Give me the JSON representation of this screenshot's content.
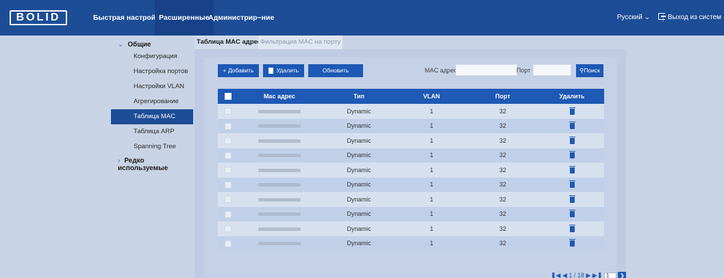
{
  "header": {
    "logo": "BOLID",
    "nav": [
      "Быстрая настройка",
      "Расширенные",
      "Администрир~ние"
    ],
    "active_nav": "Расширенные",
    "language": "Русский ⌄",
    "logout": "Выход из систем"
  },
  "sidebar": {
    "group_general": "Общие",
    "items": [
      "Конфигурация",
      "Настройка портов",
      "Настройки VLAN",
      "Агрегирование",
      "Таблица MAC",
      "Таблица ARP",
      "Spanning Tree"
    ],
    "active_item": "Таблица MAC",
    "group_rare": "Редко используемые"
  },
  "tabs": [
    "Таблица MAC адресов",
    "Фильтрация MAC на порту"
  ],
  "toolbar": {
    "add": "+  Добавить",
    "delete": "Удалить",
    "refresh": "Обновить",
    "mac_label": "MAC адрес",
    "port_label": "Порт",
    "search": "Поиск"
  },
  "table": {
    "headers": [
      "Mac адрес",
      "Тип",
      "VLAN",
      "Порт",
      "Удалить"
    ],
    "rows": [
      {
        "type": "Dynamic",
        "vlan": "1",
        "port": "32"
      },
      {
        "type": "Dynamic",
        "vlan": "1",
        "port": "32"
      },
      {
        "type": "Dynamic",
        "vlan": "1",
        "port": "32"
      },
      {
        "type": "Dynamic",
        "vlan": "1",
        "port": "32"
      },
      {
        "type": "Dynamic",
        "vlan": "1",
        "port": "32"
      },
      {
        "type": "Dynamic",
        "vlan": "1",
        "port": "32"
      },
      {
        "type": "Dynamic",
        "vlan": "1",
        "port": "32"
      },
      {
        "type": "Dynamic",
        "vlan": "1",
        "port": "32"
      },
      {
        "type": "Dynamic",
        "vlan": "1",
        "port": "32"
      },
      {
        "type": "Dynamic",
        "vlan": "1",
        "port": "32"
      }
    ]
  },
  "pager": {
    "page_info": "1 / 18",
    "page_input": "1"
  },
  "colors": {
    "header_bg": "#1c4d96",
    "accent": "#1d59b5",
    "page_bg": "#c9d3e6"
  }
}
